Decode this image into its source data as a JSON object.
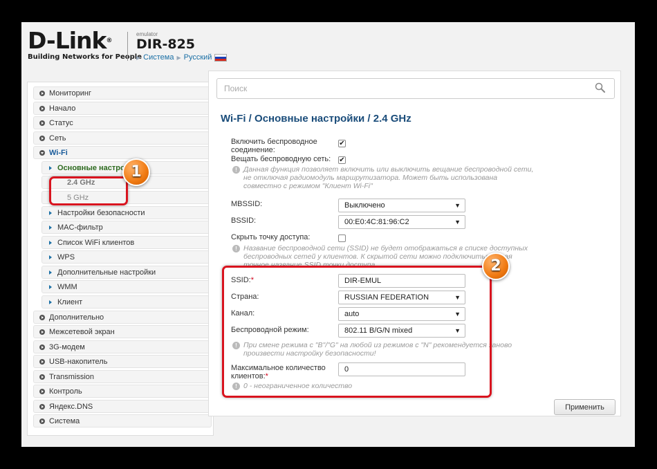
{
  "header": {
    "brand": "D-Link",
    "registered": "®",
    "slogan": "Building Networks for People",
    "emulator": "emulator",
    "model": "DIR-825",
    "crumb_system": "Система",
    "crumb_language": "Русский"
  },
  "sidebar": {
    "items": [
      {
        "label": "Мониторинг"
      },
      {
        "label": "Начало"
      },
      {
        "label": "Статус"
      },
      {
        "label": "Сеть"
      },
      {
        "label": "Wi-Fi"
      },
      {
        "label": "Дополнительно"
      },
      {
        "label": "Межсетевой экран"
      },
      {
        "label": "3G-модем"
      },
      {
        "label": "USB-накопитель"
      },
      {
        "label": "Transmission"
      },
      {
        "label": "Контроль"
      },
      {
        "label": "Яндекс.DNS"
      },
      {
        "label": "Система"
      }
    ],
    "wifi_sub": [
      {
        "label": "Основные настро"
      },
      {
        "label": "2.4 GHz"
      },
      {
        "label": "5 GHz"
      },
      {
        "label": "Настройки безопасности"
      },
      {
        "label": "MAC-фильтр"
      },
      {
        "label": "Список WiFi клиентов"
      },
      {
        "label": "WPS"
      },
      {
        "label": "Дополнительные настройки"
      },
      {
        "label": "WMM"
      },
      {
        "label": "Клиент"
      }
    ]
  },
  "search": {
    "placeholder": "Поиск"
  },
  "page": {
    "title": "Wi-Fi /  Основные настройки /  2.4 GHz"
  },
  "form": {
    "enable_wireless_label": "Включить беспроводное соединение:",
    "enable_wireless_checked": true,
    "broadcast_label": "Вещать беспроводную сеть:",
    "broadcast_checked": true,
    "broadcast_hint": "Данная функция позволяет включить или выключить вещание беспроводной сети, не отключая радиомодуль маршрутизатора. Может быть использована совместно с режимом \"Клиент Wi-Fi\"",
    "mbssid_label": "MBSSID:",
    "mbssid_value": "Выключено",
    "bssid_label": "BSSID:",
    "bssid_value": "00:E0:4C:81:96:C2",
    "hide_ap_label": "Скрыть точку доступа:",
    "hide_ap_checked": false,
    "hide_ap_hint": "Название беспроводной сети (SSID) не будет отображаться в списке доступных беспроводных сетей у клиентов. К скрытой сети можно подключиться, зная точное название SSID точки доступа",
    "ssid_label": "SSID:",
    "ssid_req": "*",
    "ssid_value": "DIR-EMUL",
    "country_label": "Страна:",
    "country_value": "RUSSIAN FEDERATION",
    "channel_label": "Канал:",
    "channel_value": "auto",
    "mode_label": "Беспроводной режим:",
    "mode_value": "802.11 B/G/N mixed",
    "mode_hint": "При смене режима с \"B\"/\"G\" на любой из режимов с \"N\" рекомендуется заново произвести настройку безопасности!",
    "max_clients_label": "Максимальное количество клиентов:",
    "max_clients_req": "*",
    "max_clients_value": "0",
    "max_clients_hint": "0 - неограниченное количество",
    "apply_label": "Применить"
  },
  "annotations": {
    "badge1": "1",
    "badge2": "2",
    "mark_color": "#d9141f",
    "badge_color": "#f07a12"
  },
  "icons": {
    "search": "search-icon",
    "info": "info-icon",
    "checkbox": "check-icon",
    "dropdown": "dropdown-arrow-icon",
    "flag": "russia-flag-icon"
  }
}
